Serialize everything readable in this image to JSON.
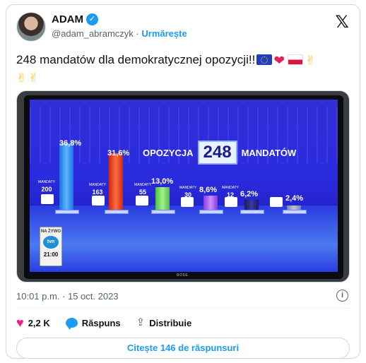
{
  "author": {
    "name": "ADAM",
    "handle": "@adam_abramczyk",
    "separator": "·",
    "follow_label": "Urmărește"
  },
  "tweet": {
    "text": "248 mandatów dla demokratycznej opozycji!!",
    "emojis": [
      "eu-flag",
      "red-heart",
      "poland-flag",
      "victory-hand",
      "victory-hand",
      "victory-hand"
    ]
  },
  "media": {
    "banner_label": "OPOZYCJA",
    "banner_number": "248",
    "banner_suffix": "MANDATÓW",
    "bars": [
      {
        "pct": "36,8%",
        "mandates": "200",
        "mandates_label": "MANDATY",
        "color": "#3aa0ff"
      },
      {
        "pct": "31,6%",
        "mandates": "163",
        "mandates_label": "MANDATY",
        "color": "#ff4a2a"
      },
      {
        "pct": "13,0%",
        "mandates": "55",
        "mandates_label": "MANDATY",
        "color": "#7be36a"
      },
      {
        "pct": "8,6%",
        "mandates": "30",
        "mandates_label": "MANDATY",
        "color": "#b070ff"
      },
      {
        "pct": "6,2%",
        "mandates": "12",
        "mandates_label": "MANDATY",
        "color": "#2a2a80"
      },
      {
        "pct": "2,4%",
        "mandates": "",
        "mandates_label": "",
        "color": "#9aa0b0"
      }
    ],
    "channel_live": "NA ŻYWO",
    "channel_name": "tvn",
    "channel_time": "21:00",
    "tv_brand": "BOSE"
  },
  "timestamp": "10:01 p.m. · 15 oct. 2023",
  "actions": {
    "likes": "2,2 K",
    "reply_label": "Răspuns",
    "share_label": "Distribuie"
  },
  "read_replies_label": "Citește 146 de răspunsuri",
  "colors": {
    "accent": "#1d9bf0",
    "like": "#f91880",
    "secondary_text": "#536471"
  }
}
